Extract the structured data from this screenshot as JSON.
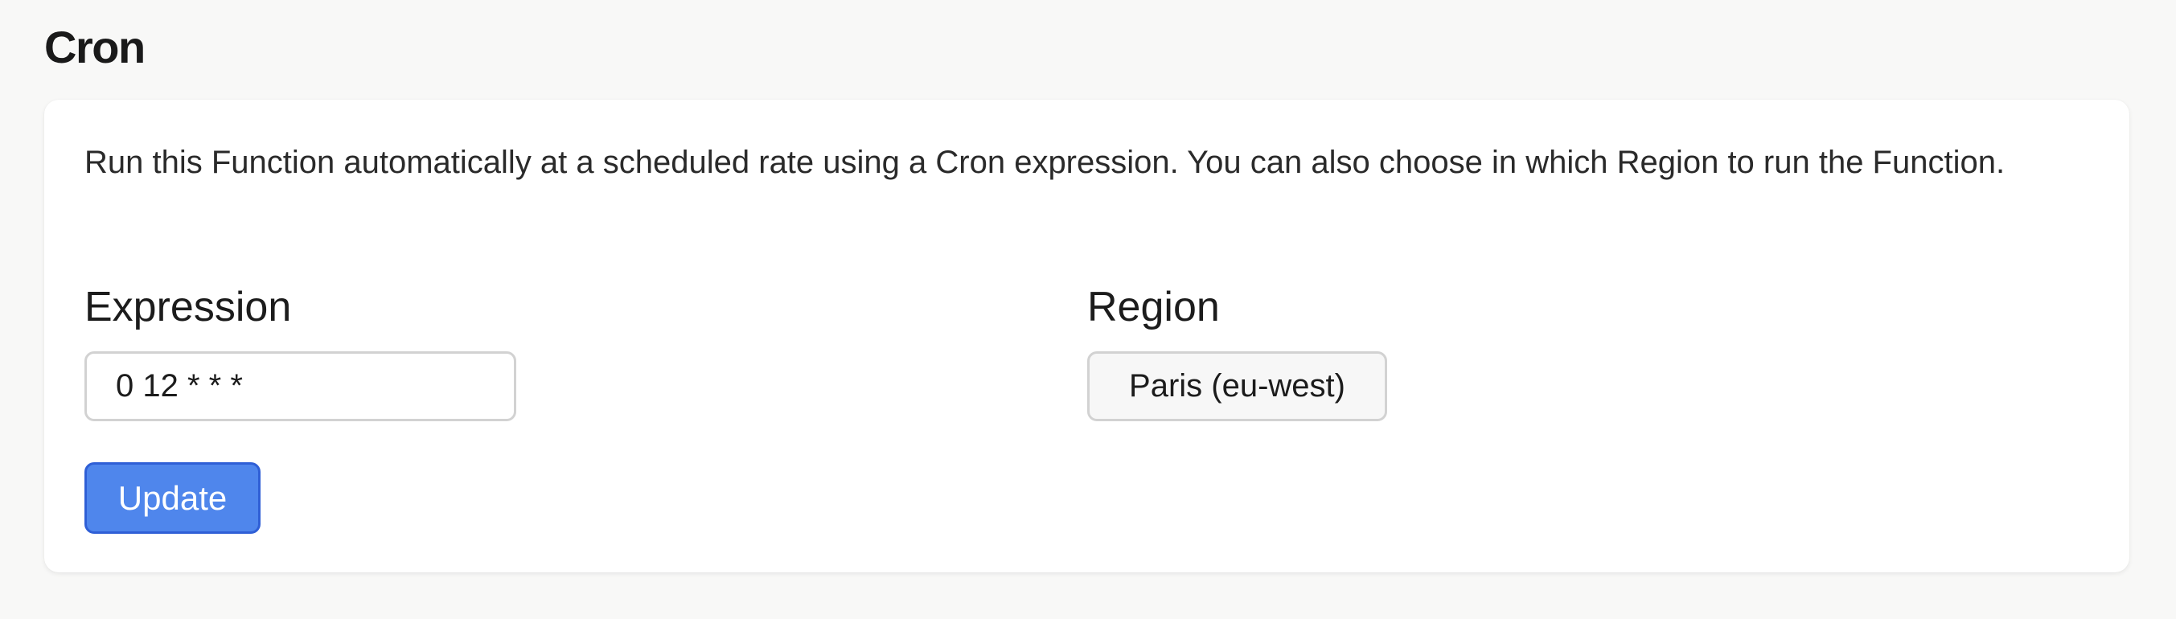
{
  "page": {
    "title": "Cron"
  },
  "card": {
    "description": "Run this Function automatically at a scheduled rate using a Cron expression. You can also choose in which Region to run the Function."
  },
  "expression": {
    "label": "Expression",
    "value": "0 12 * * *"
  },
  "region": {
    "label": "Region",
    "selected": "Paris (eu-west)"
  },
  "actions": {
    "update_label": "Update"
  },
  "colors": {
    "page_background": "#f8f8f7",
    "card_background": "#ffffff",
    "primary_button": "#4f86ec",
    "primary_button_border": "#2f5fd6"
  }
}
